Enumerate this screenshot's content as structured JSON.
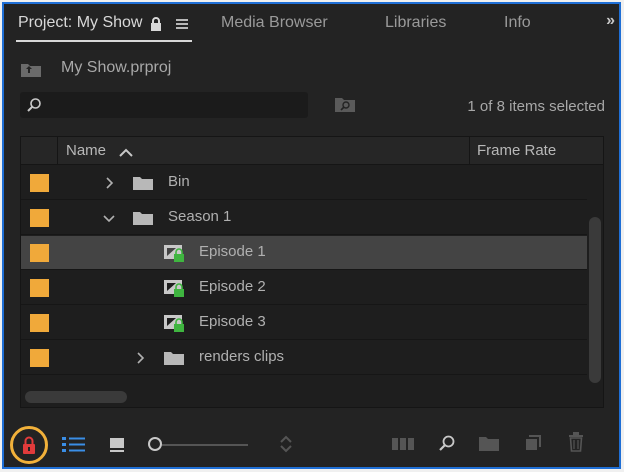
{
  "tabs": [
    {
      "label": "Project: My Show",
      "active": true
    },
    {
      "label": "Media Browser",
      "active": false
    },
    {
      "label": "Libraries",
      "active": false
    },
    {
      "label": "Info",
      "active": false
    }
  ],
  "overflow_label": "»",
  "project": {
    "file_name": "My Show.prproj"
  },
  "search": {
    "placeholder": "",
    "status": "1 of 8 items selected"
  },
  "table": {
    "columns": [
      "Name",
      "Frame Rate"
    ],
    "rows": [
      {
        "label": "Bin",
        "type": "bin",
        "expanded": false,
        "indent": 0,
        "selected": false,
        "color": "#f0a93a"
      },
      {
        "label": "Season 1",
        "type": "bin",
        "expanded": true,
        "indent": 0,
        "selected": false,
        "color": "#f0a93a"
      },
      {
        "label": "Episode 1",
        "type": "sequence-locked",
        "indent": 1,
        "selected": true,
        "color": "#f0a93a"
      },
      {
        "label": "Episode 2",
        "type": "sequence-locked",
        "indent": 1,
        "selected": false,
        "color": "#f0a93a"
      },
      {
        "label": "Episode 3",
        "type": "sequence-locked",
        "indent": 1,
        "selected": false,
        "color": "#f0a93a"
      },
      {
        "label": "renders clips",
        "type": "bin",
        "expanded": false,
        "indent": 1,
        "selected": false,
        "color": "#f0a93a"
      }
    ]
  },
  "colors": {
    "accent": "#1f6fd6",
    "lock_ring": "#f2b13a",
    "lock_red": "#e23b3b",
    "label_orange": "#f0a93a",
    "lock_green": "#3fb540"
  }
}
